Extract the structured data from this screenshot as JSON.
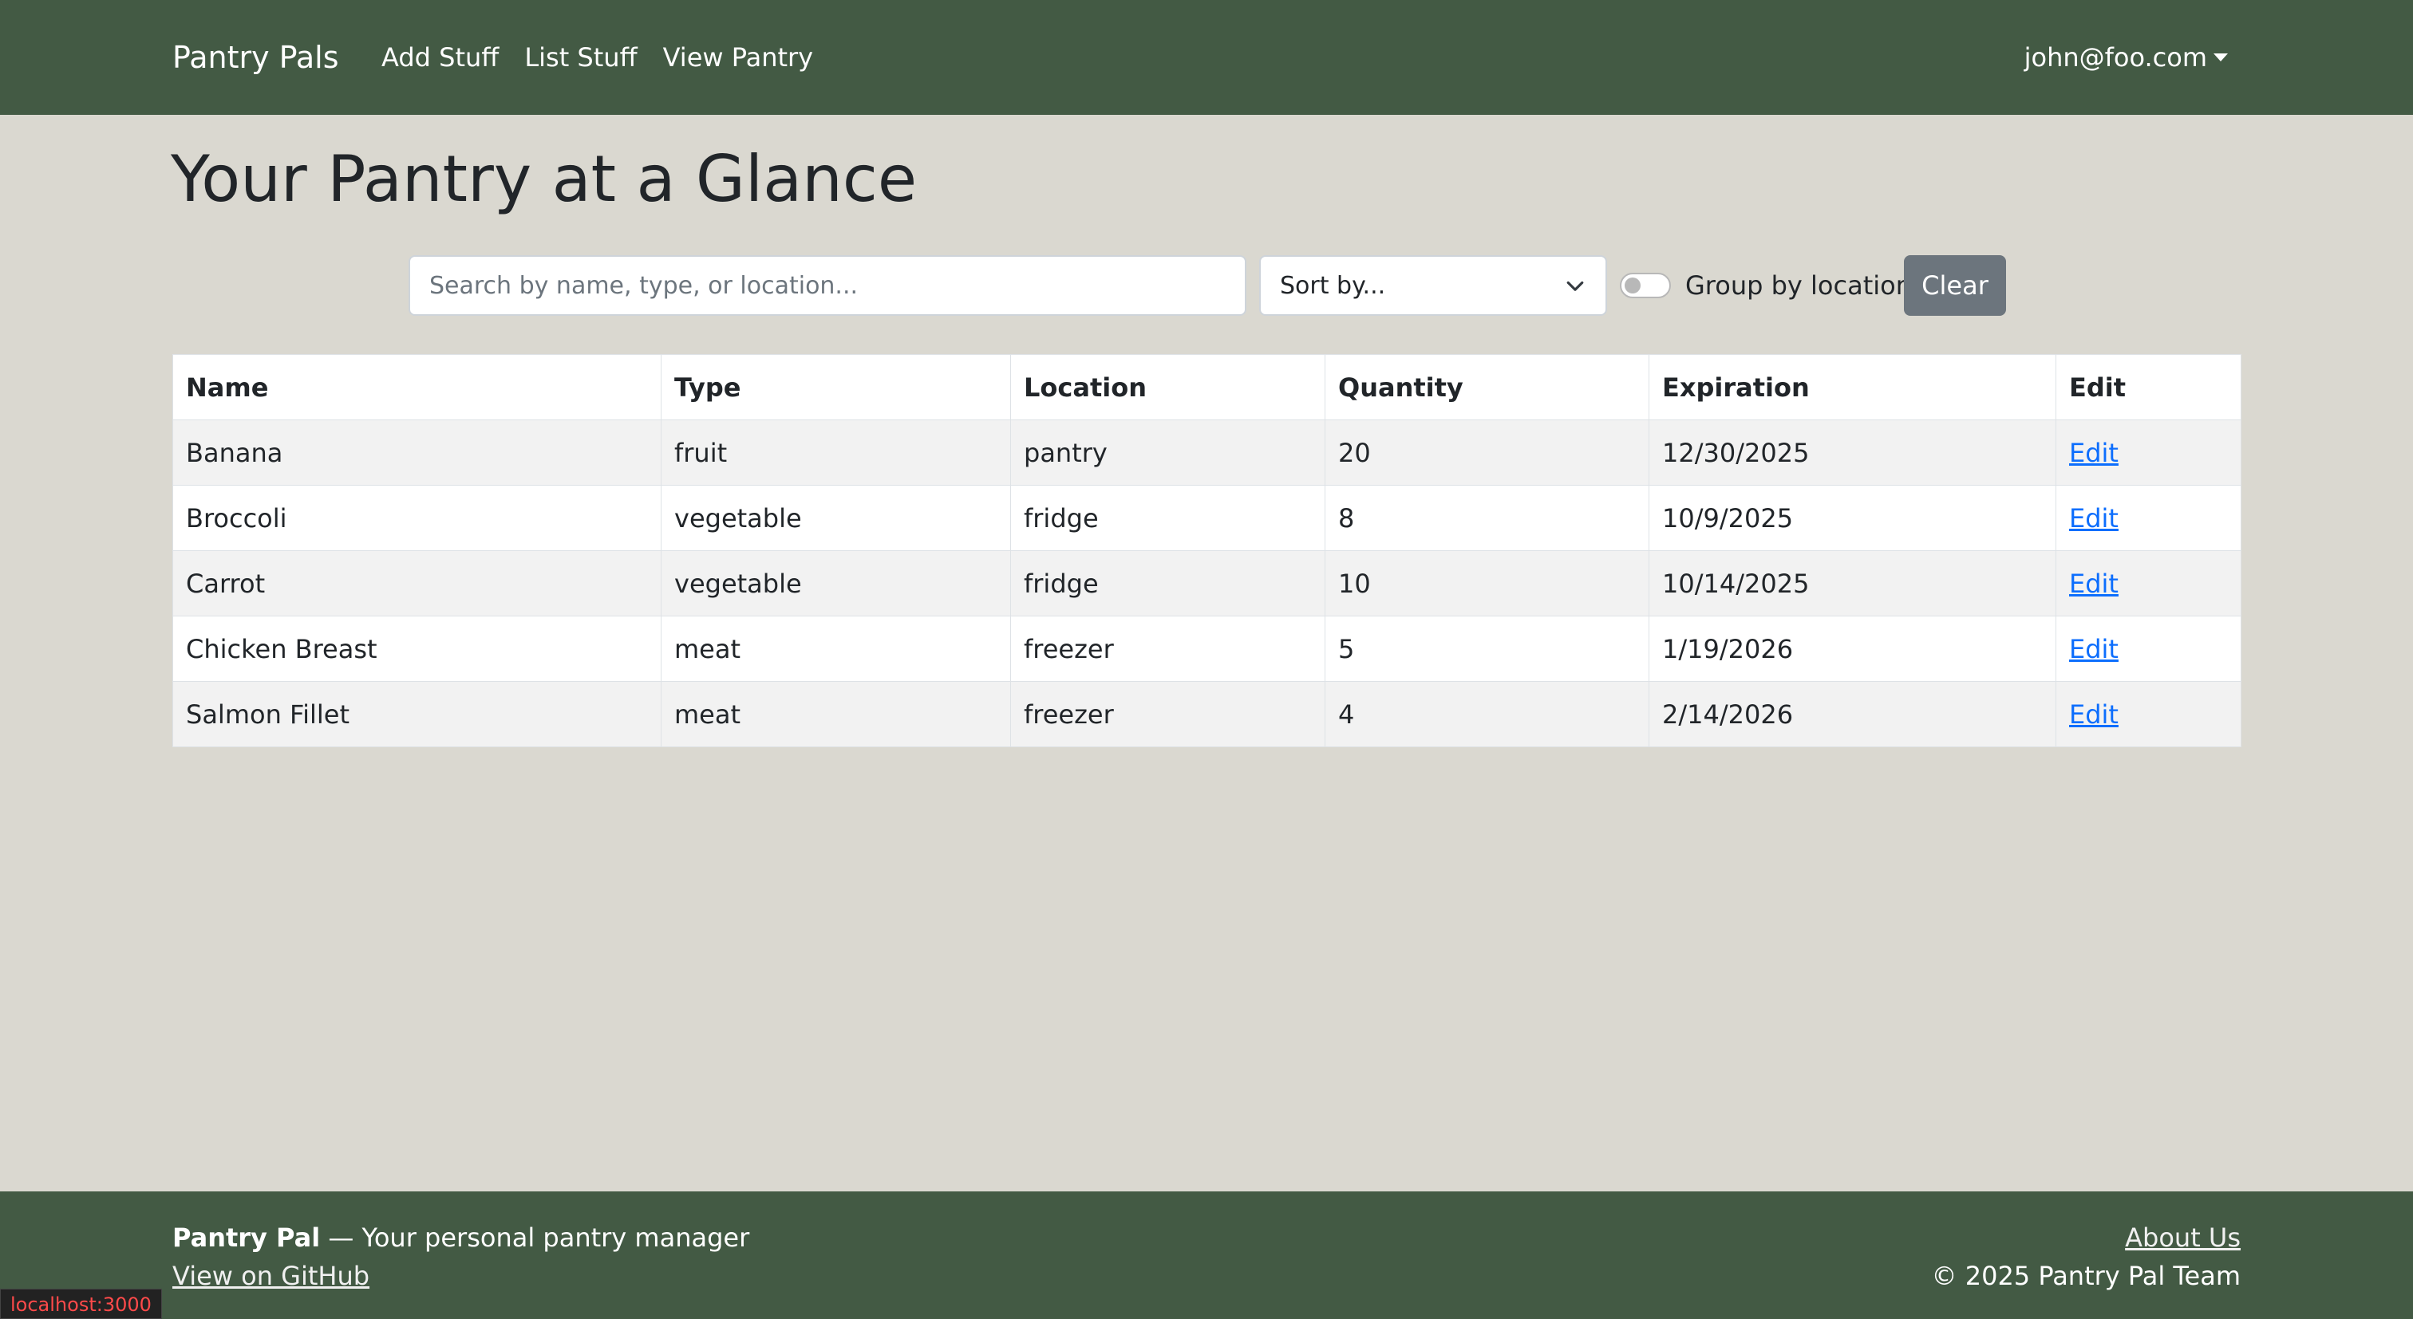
{
  "navbar": {
    "brand": "Pantry Pals",
    "links": [
      "Add Stuff",
      "List Stuff",
      "View Pantry"
    ],
    "user": "john@foo.com"
  },
  "page": {
    "title": "Your Pantry at a Glance"
  },
  "filters": {
    "search_placeholder": "Search by name, type, or location...",
    "sort_value": "Sort by...",
    "group_label": "Group by location",
    "group_enabled": false,
    "clear_label": "Clear"
  },
  "table": {
    "headers": [
      "Name",
      "Type",
      "Location",
      "Quantity",
      "Expiration",
      "Edit"
    ],
    "rows": [
      [
        "Banana",
        "fruit",
        "pantry",
        "20",
        "12/30/2025",
        "Edit"
      ],
      [
        "Broccoli",
        "vegetable",
        "fridge",
        "8",
        "10/9/2025",
        "Edit"
      ],
      [
        "Carrot",
        "vegetable",
        "fridge",
        "10",
        "10/14/2025",
        "Edit"
      ],
      [
        "Chicken Breast",
        "meat",
        "freezer",
        "5",
        "1/19/2026",
        "Edit"
      ],
      [
        "Salmon Fillet",
        "meat",
        "freezer",
        "4",
        "2/14/2026",
        "Edit"
      ]
    ]
  },
  "footer": {
    "brand": "Pantry Pal",
    "tagline": " — Your personal pantry manager",
    "github": "View on GitHub",
    "about": "About Us",
    "copyright": "© 2025 Pantry Pal Team"
  },
  "badge": "localhost:3000",
  "colors": {
    "nav_bg": "#435a44",
    "page_bg": "#dad8d0",
    "link": "#0d6efd",
    "button_secondary": "#6c757d"
  }
}
